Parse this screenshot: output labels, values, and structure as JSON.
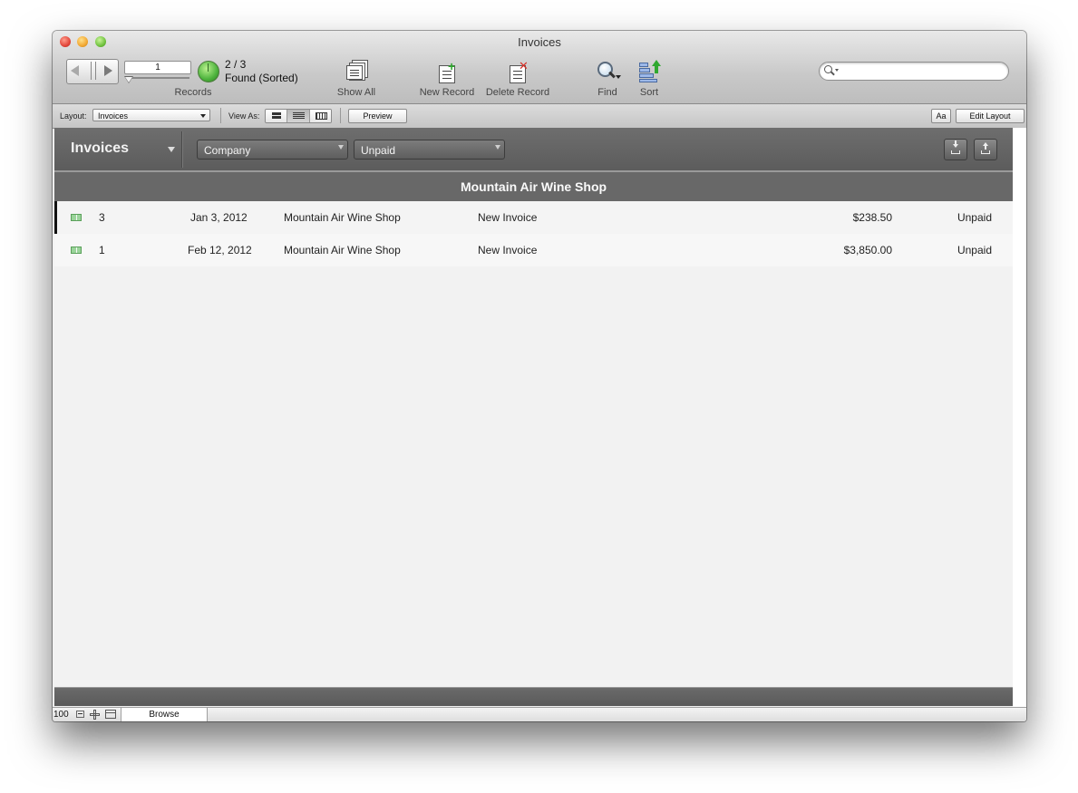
{
  "window": {
    "title": "Invoices"
  },
  "toolbar": {
    "record_number": "1",
    "found_count": "2 / 3",
    "found_status": "Found (Sorted)",
    "records_label": "Records",
    "show_all_label": "Show All",
    "new_record_label": "New Record",
    "delete_record_label": "Delete Record",
    "find_label": "Find",
    "sort_label": "Sort",
    "search_placeholder": ""
  },
  "layoutbar": {
    "layout_label": "Layout:",
    "layout_value": "Invoices",
    "view_as_label": "View As:",
    "view_modes": [
      "form-view-icon",
      "list-view-icon",
      "table-view-icon"
    ],
    "active_view": "list-view-icon",
    "preview_label": "Preview",
    "text_format_label": "Aa",
    "edit_layout_label": "Edit Layout"
  },
  "content": {
    "header_title": "Invoices",
    "filter_company": "Company",
    "filter_status": "Unpaid",
    "group_title": "Mountain Air Wine Shop",
    "rows": [
      {
        "number": "3",
        "date": "Jan 3, 2012",
        "company": "Mountain Air Wine Shop",
        "type": "New Invoice",
        "amount": "$238.50",
        "status": "Unpaid"
      },
      {
        "number": "1",
        "date": "Feb 12, 2012",
        "company": "Mountain Air Wine Shop",
        "type": "New Invoice",
        "amount": "$3,850.00",
        "status": "Unpaid"
      }
    ]
  },
  "statusbar": {
    "zoom": "100",
    "mode": "Browse"
  },
  "colors": {
    "header_bg": "#5c5c5c",
    "group_bg": "#686868",
    "content_bg": "#f2f2f2",
    "accent_green": "#4db33d"
  }
}
